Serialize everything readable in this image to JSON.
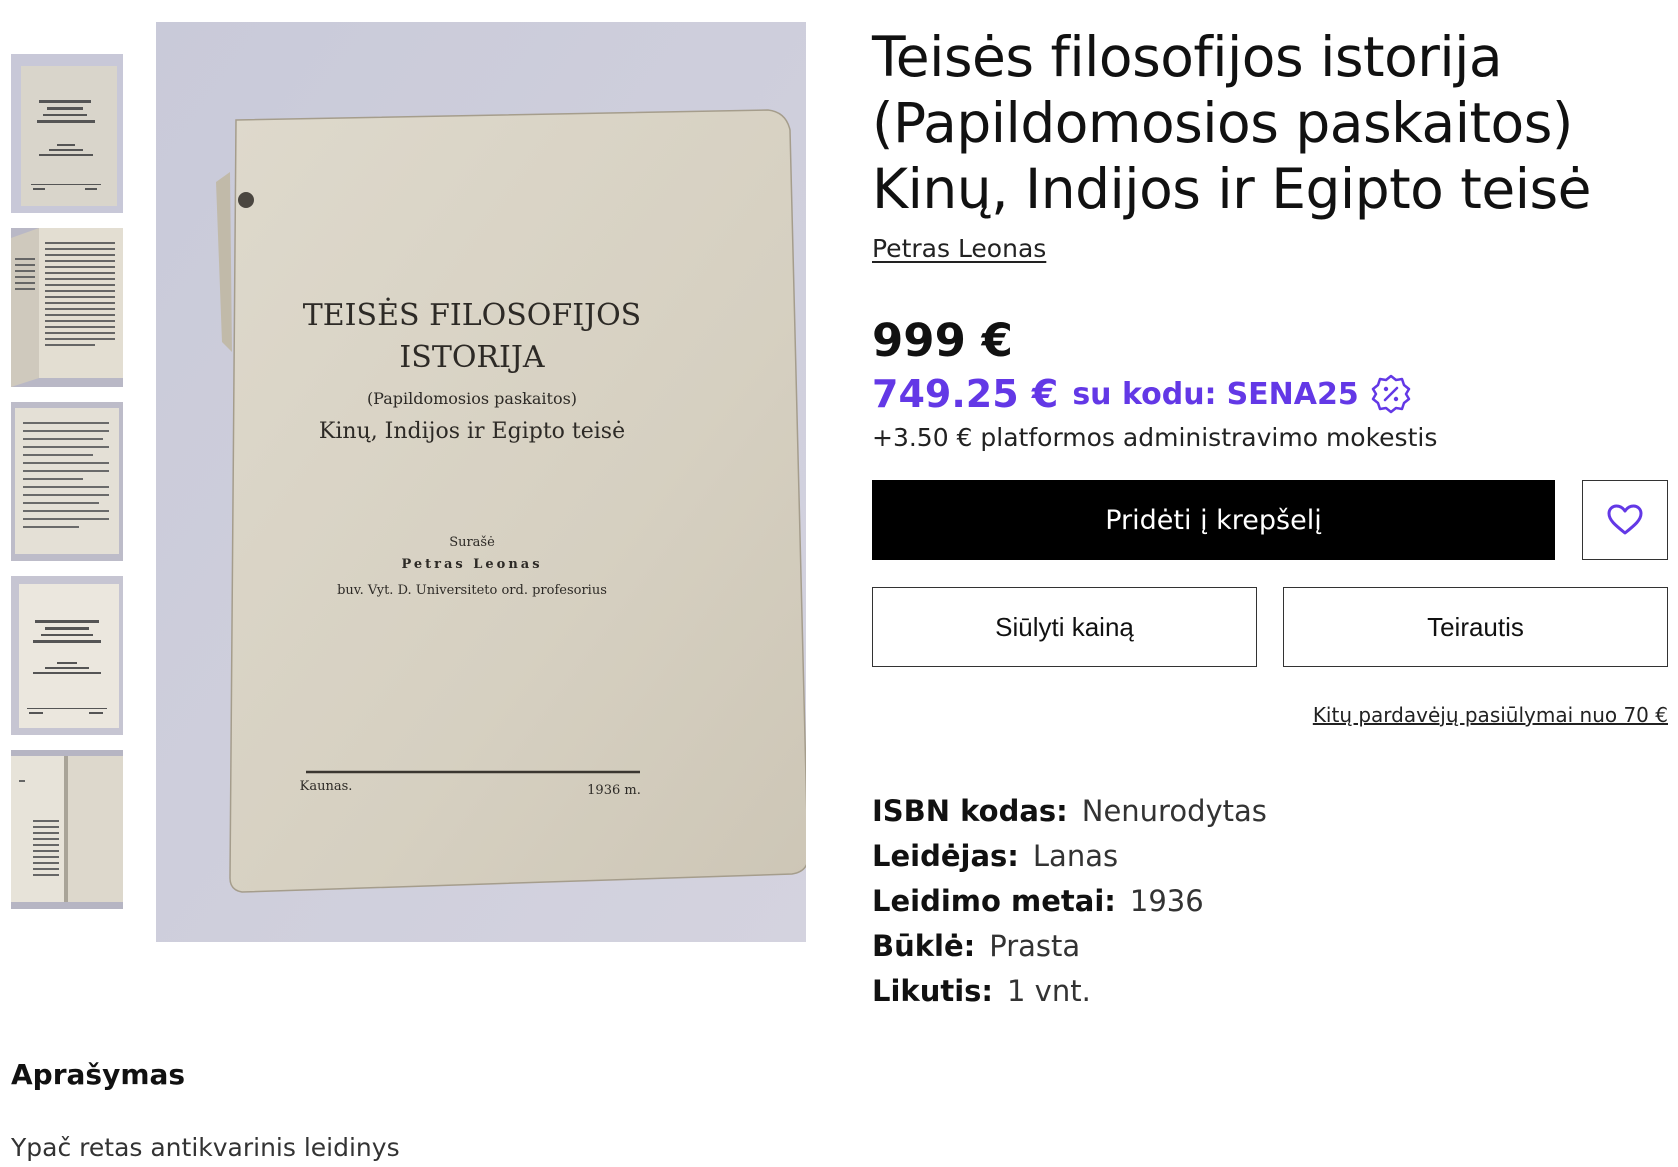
{
  "gallery": {
    "thumbnails": [
      {
        "name": "cover"
      },
      {
        "name": "inside-pages-1"
      },
      {
        "name": "inside-pages-2"
      },
      {
        "name": "title-page"
      },
      {
        "name": "inside-pages-3"
      }
    ],
    "main_image": {
      "cover_line1": "TEISĖS FILOSOFIJOS",
      "cover_line2": "ISTORIJA",
      "cover_line3": "(Papildomosios paskaitos)",
      "cover_line4": "Kinų, Indijos ir Egipto teisė",
      "cover_compiled": "Surašė",
      "cover_author": "Petras Leonas",
      "cover_affiliation": "buv. Vyt. D. Universiteto ord. profesorius",
      "cover_city": "Kaunas.",
      "cover_year": "1936 m."
    }
  },
  "product": {
    "title": "Teisės filosofijos istorija (Papildomosios paskaitos) Kinų, Indijos ir Egipto teisė",
    "author": "Petras Leonas",
    "price_old": "999 €",
    "price_new": "749.25 €",
    "promo_text": "su kodu:",
    "promo_code": "SENA25",
    "promo_icon": "discount-badge-icon",
    "fee": "+3.50 € platformos administravimo mokestis",
    "add_to_cart": "Pridėti į krepšelį",
    "wishlist_icon": "heart-icon",
    "offer_price": "Siūlyti kainą",
    "inquire": "Teirautis",
    "other_offers": "Kitų pardavėjų pasiūlymai nuo 70 €",
    "accent_color": "#6338e6"
  },
  "specs": [
    {
      "label": "ISBN kodas:",
      "value": "Nenurodytas"
    },
    {
      "label": "Leidėjas:",
      "value": "Lanas"
    },
    {
      "label": "Leidimo metai:",
      "value": "1936"
    },
    {
      "label": "Būklė:",
      "value": "Prasta"
    },
    {
      "label": "Likutis:",
      "value": "1 vnt."
    }
  ],
  "description": {
    "heading": "Aprašymas",
    "text": "Ypač retas antikvarinis leidinys"
  }
}
